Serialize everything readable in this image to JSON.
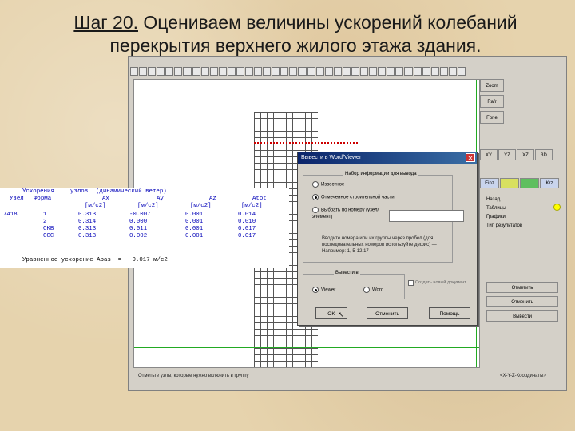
{
  "slide": {
    "title_step": "Шаг 20.",
    "title_rest": " Оцениваем величины ускорений колебаний перекрытия верхнего жилого этажа здания."
  },
  "app": {
    "view_buttons": [
      "Zoom",
      "Rafr",
      "Fone"
    ],
    "axis_buttons": [
      "XY",
      "YZ",
      "XZ",
      "3D"
    ],
    "e_buttons": [
      "Einz",
      "",
      "",
      "Krz"
    ],
    "menu_items": [
      "Назад",
      "Таблицы",
      "Графики",
      "Тип результатов"
    ],
    "right_buttons": [
      "Отметить",
      "Отменить",
      "Вывести"
    ],
    "status_text": "Отметьте узлы, которые нужно включить в группу",
    "coords_label": "<X-Y-Z-Координаты>"
  },
  "dialog": {
    "title": "Вывести в Word/Viewer",
    "group1_label": "Набор информации для вывода",
    "options": [
      "Известное",
      "Отмеченное строительной части",
      "Выбрать по номеру (узел/элемент)"
    ],
    "note": "Вводите номера или их группы через пробел (для последовательных номеров используйте дефис) — Например: 1, 5-12,17",
    "group2_label": "Вывести в",
    "output_options": [
      "Viewer",
      "Word"
    ],
    "checkbox_label": "Создать новый документ",
    "ok_label": "OK",
    "cancel_label": "Отменить",
    "help_label": "Помощь"
  },
  "report": {
    "header1": [
      "Ускорения",
      "узлов",
      "(динамический ветер)"
    ],
    "header2": [
      "Узел",
      "Форма",
      "Ax",
      "Ay",
      "Az",
      "Atot"
    ],
    "header3": [
      "[м/c2]",
      "[м/c2]",
      "[м/c2]",
      "[м/c2]"
    ],
    "rows": [
      [
        "7418",
        "1",
        "0.313",
        "-0.007",
        "0.001",
        "0.014"
      ],
      [
        "",
        "2",
        "0.314",
        "0.000",
        "0.001",
        "0.010"
      ],
      [
        "",
        "СКВ",
        "0.313",
        "0.011",
        "0.001",
        "0.017"
      ],
      [
        "",
        "ССС",
        "0.313",
        "0.002",
        "0.001",
        "0.017"
      ]
    ],
    "footer_label": "Уравненное ускорение Abas  =",
    "footer_value": "0.017 м/с2"
  }
}
